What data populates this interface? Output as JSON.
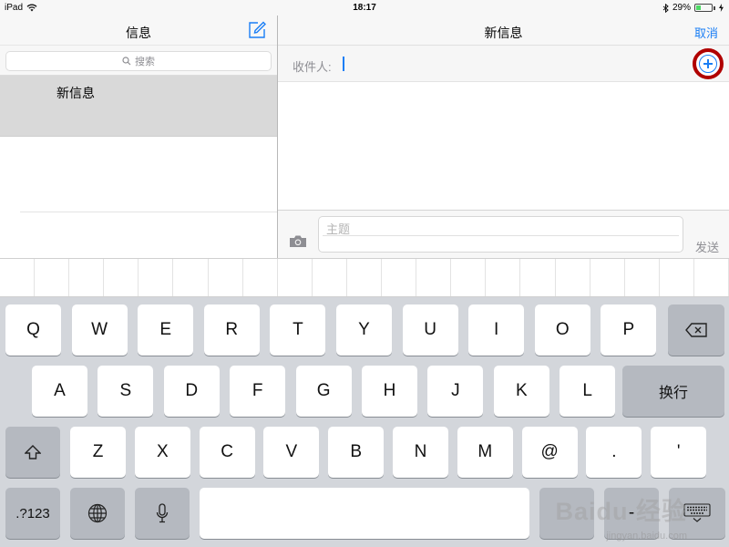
{
  "status": {
    "device": "iPad",
    "time": "18:17",
    "battery_text": "29%",
    "battery_level": 0.29
  },
  "left": {
    "title": "信息",
    "search_placeholder": "搜索",
    "selected_conversation": "新信息"
  },
  "right": {
    "title": "新信息",
    "cancel": "取消",
    "recipient_label": "收件人:",
    "subject_placeholder": "主题",
    "send": "发送"
  },
  "keyboard": {
    "row1": [
      "Q",
      "W",
      "E",
      "R",
      "T",
      "Y",
      "U",
      "I",
      "O",
      "P"
    ],
    "row2": [
      "A",
      "S",
      "D",
      "F",
      "G",
      "H",
      "J",
      "K",
      "L"
    ],
    "return_label": "换行",
    "row3": [
      "Z",
      "X",
      "C",
      "V",
      "B",
      "N",
      "M",
      "@",
      ".",
      "'"
    ],
    "numbers_label": ".?123",
    "dash_label": "-"
  },
  "watermark": {
    "brand": "Baidu 经验",
    "url": "jingyan.baidu.com"
  },
  "colors": {
    "accent": "#1a7ef5",
    "highlight_ring": "#b00000"
  }
}
